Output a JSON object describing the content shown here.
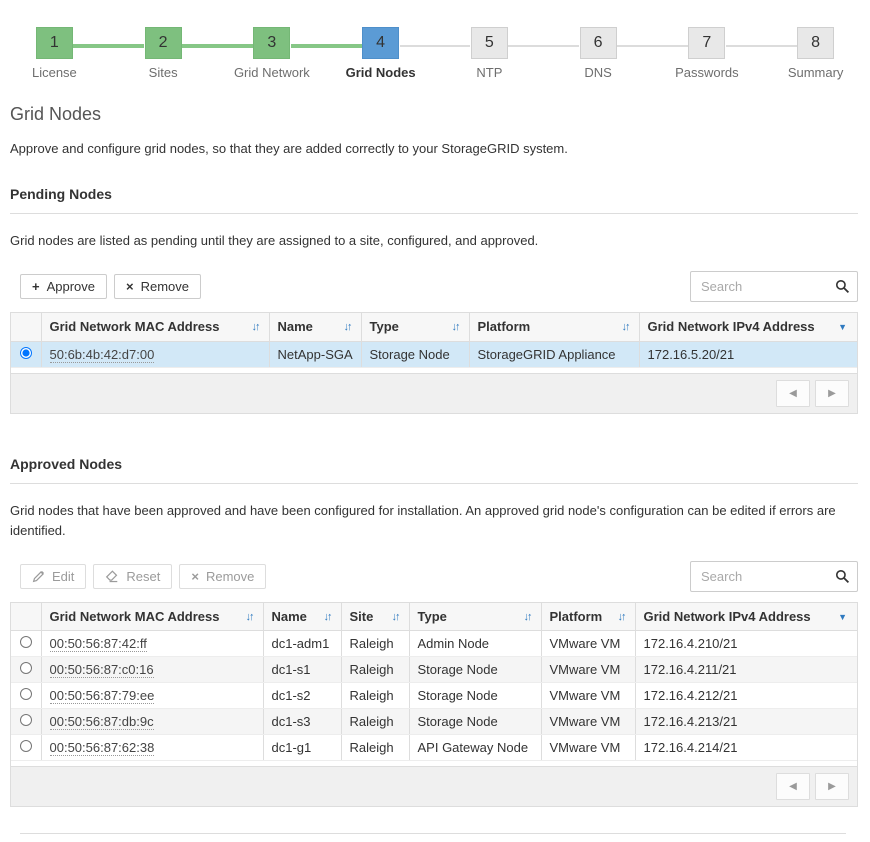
{
  "stepper": {
    "steps": [
      {
        "number": "1",
        "label": "License",
        "state": "complete"
      },
      {
        "number": "2",
        "label": "Sites",
        "state": "complete"
      },
      {
        "number": "3",
        "label": "Grid Network",
        "state": "complete"
      },
      {
        "number": "4",
        "label": "Grid Nodes",
        "state": "current"
      },
      {
        "number": "5",
        "label": "NTP",
        "state": "upcoming"
      },
      {
        "number": "6",
        "label": "DNS",
        "state": "upcoming"
      },
      {
        "number": "7",
        "label": "Passwords",
        "state": "upcoming"
      },
      {
        "number": "8",
        "label": "Summary",
        "state": "upcoming"
      }
    ]
  },
  "page": {
    "title": "Grid Nodes",
    "description": "Approve and configure grid nodes, so that they are added correctly to your StorageGRID system."
  },
  "pending": {
    "heading": "Pending Nodes",
    "description": "Grid nodes are listed as pending until they are assigned to a site, configured, and approved.",
    "toolbar": {
      "approve": "Approve",
      "remove": "Remove"
    },
    "search_placeholder": "Search",
    "columns": [
      "Grid Network MAC Address",
      "Name",
      "Type",
      "Platform",
      "Grid Network IPv4 Address"
    ],
    "rows": [
      {
        "mac": "50:6b:4b:42:d7:00",
        "name": "NetApp-SGA",
        "type": "Storage Node",
        "platform": "StorageGRID Appliance",
        "ipv4": "172.16.5.20/21",
        "selected": true
      }
    ]
  },
  "approved": {
    "heading": "Approved Nodes",
    "description": "Grid nodes that have been approved and have been configured for installation. An approved grid node's configuration can be edited if errors are identified.",
    "toolbar": {
      "edit": "Edit",
      "reset": "Reset",
      "remove": "Remove"
    },
    "search_placeholder": "Search",
    "columns": [
      "Grid Network MAC Address",
      "Name",
      "Site",
      "Type",
      "Platform",
      "Grid Network IPv4 Address"
    ],
    "rows": [
      {
        "mac": "00:50:56:87:42:ff",
        "name": "dc1-adm1",
        "site": "Raleigh",
        "type": "Admin Node",
        "platform": "VMware VM",
        "ipv4": "172.16.4.210/21"
      },
      {
        "mac": "00:50:56:87:c0:16",
        "name": "dc1-s1",
        "site": "Raleigh",
        "type": "Storage Node",
        "platform": "VMware VM",
        "ipv4": "172.16.4.211/21"
      },
      {
        "mac": "00:50:56:87:79:ee",
        "name": "dc1-s2",
        "site": "Raleigh",
        "type": "Storage Node",
        "platform": "VMware VM",
        "ipv4": "172.16.4.212/21"
      },
      {
        "mac": "00:50:56:87:db:9c",
        "name": "dc1-s3",
        "site": "Raleigh",
        "type": "Storage Node",
        "platform": "VMware VM",
        "ipv4": "172.16.4.213/21"
      },
      {
        "mac": "00:50:56:87:62:38",
        "name": "dc1-g1",
        "site": "Raleigh",
        "type": "API Gateway Node",
        "platform": "VMware VM",
        "ipv4": "172.16.4.214/21"
      }
    ]
  },
  "icons": {
    "plus": "+",
    "x": "×",
    "prev": "◀",
    "next": "▶",
    "sort": "↓↑",
    "caret_down": "▼"
  },
  "colors": {
    "step_complete": "#7ec07f",
    "step_current": "#5b9bd5",
    "step_upcoming": "#e8e8e8",
    "sort_icon": "#2f7ac0",
    "selected_row": "#d2e8f7"
  }
}
